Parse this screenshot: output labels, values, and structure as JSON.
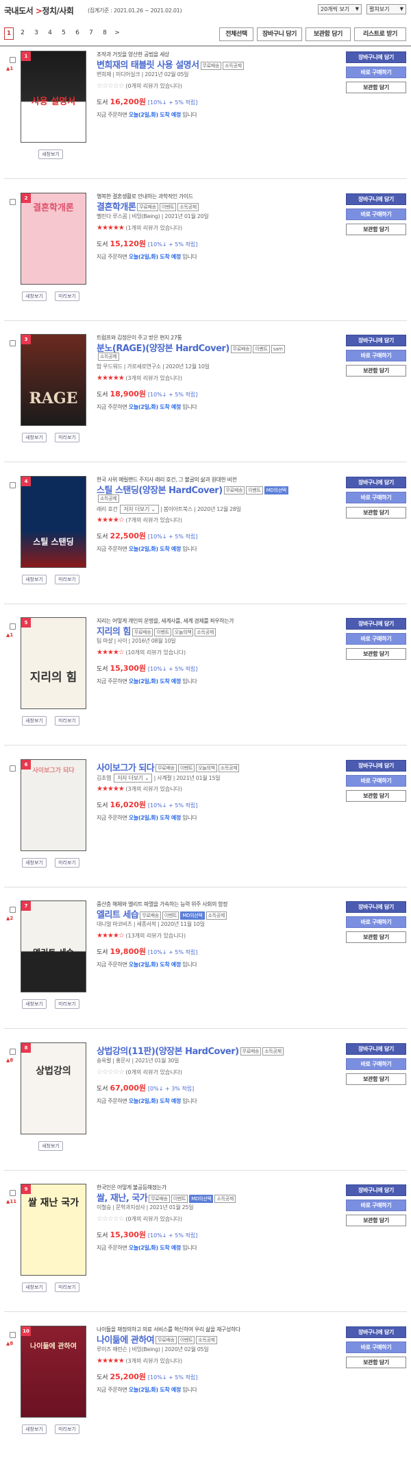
{
  "header": {
    "category": "국내도서",
    "sep": " >",
    "subcategory": "정치/사회",
    "period": "(집계기준 : 2021.01.26 ~ 2021.02.01)",
    "sel_count": "20개씩 보기",
    "sel_view": "펼쳐보기"
  },
  "pager": {
    "pages": [
      "1",
      "2",
      "3",
      "4",
      "5",
      "6",
      "7",
      "8"
    ],
    "next": ">"
  },
  "actions": {
    "select_all": "전체선택",
    "cart": "장바구니 담기",
    "save": "보관함 담기",
    "list": "리스트로 받기"
  },
  "labels": {
    "preview": "새창보기",
    "peek": "미리보기",
    "cart": "장바구니에 담기",
    "buy": "바로 구매하기",
    "save": "보관함 담기",
    "price_prefix": "도서",
    "deliv_prefix": "지금 주문하면",
    "deliv_bold": "오늘(2일,화) 도착 예정",
    "deliv_suffix": "입니다",
    "author_more": "저자 더보기"
  },
  "items": [
    {
      "rank": "1",
      "delta": "▲1",
      "sub": "조작과 거짓을 양산한 공범을 세상",
      "title": "변희재의 태블릿 사용 설명서",
      "tags": [
        "무료배송",
        "소득공제"
      ],
      "meta": "변희재 | 미디어실크 | 2021년 02월 05일",
      "stars": "☆☆☆☆☆",
      "empty": true,
      "review": "(0개의 리뷰가 있습니다)",
      "price": "16,200원",
      "disc": "[10%↓ + 5% 적립]",
      "cover": "사용 설명서",
      "one_btn": true
    },
    {
      "rank": "2",
      "delta": "",
      "sub": "행복한 결혼생활로 안내하는 과학적인 가이드",
      "title": "결혼학개론",
      "tags": [
        "무료배송",
        "이벤트",
        "소득공제"
      ],
      "meta": "벨린다 루스콤 | 비잉(Being) | 2021년 01월 20일",
      "stars": "★★★★★",
      "empty": false,
      "review": "(1개의 리뷰가 있습니다)",
      "price": "15,120원",
      "disc": "[10%↓ + 5% 적립]",
      "cover": "결혼학개론",
      "one_btn": false
    },
    {
      "rank": "3",
      "delta": "",
      "sub": "트럼프와 김정은이 주고 받은 편지 27통",
      "title": "분노(RAGE)(양장본 HardCover)",
      "tags": [
        "무료배송",
        "이벤트",
        "sam"
      ],
      "tags2": [
        "소득공제"
      ],
      "meta": "밥 우드워드 | 가로세로연구소 | 2020년 12월 10일",
      "stars": "★★★★★",
      "empty": false,
      "review": "(3개의 리뷰가 있습니다)",
      "price": "18,900원",
      "disc": "[10%↓ + 5% 적립]",
      "cover": "RAGE",
      "one_btn": false
    },
    {
      "rank": "4",
      "delta": "",
      "sub": "한국 사위 메릴랜드 주지사 래리 호건, 그 불굴의 삶과 원대한 비전",
      "title": "스틸 스탠딩(양장본 HardCover)",
      "tags": [
        "무료배송",
        "이벤트",
        "MD의선택"
      ],
      "tags2": [
        "소득공제"
      ],
      "meta": "래리 호건",
      "meta2": "| 봄이아트북스 | 2020년 12월 28일",
      "author_sel": true,
      "stars": "★★★★☆",
      "empty": false,
      "review": "(7개의 리뷰가 있습니다)",
      "price": "22,500원",
      "disc": "[10%↓ + 5% 적립]",
      "cover": "스틸 스탠딩",
      "one_btn": false
    },
    {
      "rank": "5",
      "delta": "▲1",
      "sub": "지리는 어떻게 개인의 운명을, 세계사를, 세계 경제를 좌우하는가",
      "title": "지리의 힘",
      "tags": [
        "무료배송",
        "이벤트",
        "오늘의책",
        "소득공제"
      ],
      "meta": "팀 마샬 | 사이 | 2016년 08월 10일",
      "stars": "★★★★☆",
      "empty": false,
      "review": "(10개의 리뷰가 있습니다)",
      "price": "15,300원",
      "disc": "[10%↓ + 5% 적립]",
      "cover": "지리의 힘",
      "one_btn": false
    },
    {
      "rank": "6",
      "delta": "",
      "sub": "",
      "title": "사이보그가 되다",
      "tags": [
        "무료배송",
        "이벤트",
        "오늘의책",
        "소득공제"
      ],
      "meta": "김초엽",
      "meta2": "| 사계절 | 2021년 01월 15일",
      "author_sel": true,
      "stars": "★★★★★",
      "empty": false,
      "review": "(3개의 리뷰가 있습니다)",
      "price": "16,020원",
      "disc": "[10%↓ + 5% 적립]",
      "cover": "사이보그가 되다",
      "one_btn": false
    },
    {
      "rank": "7",
      "delta": "▲2",
      "sub": "중산층 해체와 엘리트 파멸을 가속하는 능력 위주 사회의 함정",
      "title": "엘리트 세습",
      "tags": [
        "무료배송",
        "이벤트",
        "MD의선택",
        "소득공제"
      ],
      "meta": "대니얼 마코비츠 | 세종서적 | 2020년 11월 10일",
      "stars": "★★★★☆",
      "empty": false,
      "review": "(13개의 리뷰가 있습니다)",
      "price": "19,800원",
      "disc": "[10%↓ + 5% 적립]",
      "cover": "엘리트 세습",
      "one_btn": false
    },
    {
      "rank": "8",
      "delta": "▲8",
      "sub": "",
      "title": "상법강의(11판)(양장본 HardCover)",
      "tags": [
        "무료배송",
        "소득공제"
      ],
      "meta": "송옥렬 | 홍문사 | 2021년 01월 30일",
      "stars": "☆☆☆☆☆",
      "empty": true,
      "review": "(0개의 리뷰가 있습니다)",
      "price": "67,000원",
      "disc": "[0%↓ + 3% 적립]",
      "cover": "상법강의",
      "one_btn": true
    },
    {
      "rank": "9",
      "delta": "▲11",
      "sub": "한국인은 어떻게 불공등해졌는가",
      "title": "쌀, 재난, 국가",
      "tags": [
        "무료배송",
        "이벤트",
        "MD의선택",
        "소득공제"
      ],
      "meta": "이철승 | 문학과지성사 | 2021년 01월 25일",
      "stars": "☆☆☆☆☆",
      "empty": true,
      "review": "(0개의 리뷰가 있습니다)",
      "price": "15,300원",
      "disc": "[10%↓ + 5% 적립]",
      "cover": "쌀 재난 국가",
      "one_btn": false
    },
    {
      "rank": "10",
      "delta": "▲8",
      "sub": "나이듦을 재정의하고 의료 서비스를 혁신하여 우리 삶을 재구성하다",
      "title": "나이듦에 관하여",
      "tags": [
        "무료배송",
        "이벤트",
        "소득공제"
      ],
      "meta": "루이즈 애런슨 | 비잉(Being) | 2020년 02월 05일",
      "stars": "★★★★★",
      "empty": false,
      "review": "(3개의 리뷰가 있습니다)",
      "price": "25,200원",
      "disc": "[10%↓ + 5% 적립]",
      "cover": "나이듦에 관하여",
      "one_btn": false
    }
  ]
}
